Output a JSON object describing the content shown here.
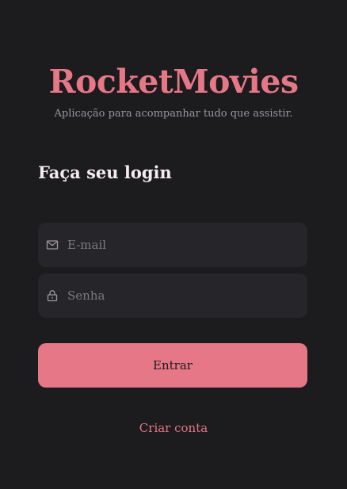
{
  "brand": {
    "title": "RocketMovies",
    "subtitle": "Aplicação para acompanhar tudo que assistir."
  },
  "form": {
    "title": "Faça seu login",
    "email": {
      "placeholder": "E-mail",
      "value": "",
      "icon": "mail-icon"
    },
    "password": {
      "placeholder": "Senha",
      "value": "",
      "icon": "lock-icon"
    },
    "submit_label": "Entrar",
    "create_account_label": "Criar conta"
  },
  "colors": {
    "background": "#1c1b1e",
    "accent": "#e57787",
    "input_background": "#262529",
    "placeholder": "#7c7a80",
    "heading": "#f4edef",
    "subtitle": "#9b989e"
  }
}
